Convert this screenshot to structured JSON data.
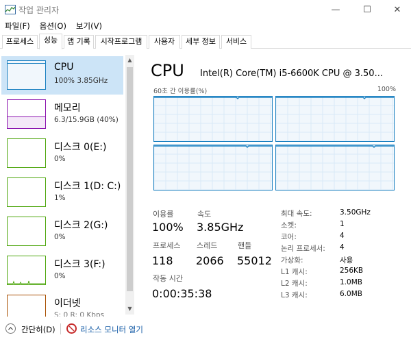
{
  "window": {
    "title": "작업 관리자",
    "minimize": "—",
    "maximize": "☐",
    "close": "✕"
  },
  "menu": [
    "파일(F)",
    "옵션(O)",
    "보기(V)"
  ],
  "tabs": [
    "프로세스",
    "성능",
    "앱 기록",
    "시작프로그램",
    "사용자",
    "세부 정보",
    "서비스"
  ],
  "sidebar": [
    {
      "name": "CPU",
      "sub": "100% 3.85GHz",
      "color": "#1a80c0"
    },
    {
      "name": "메모리",
      "sub": "6.3/15.9GB (40%)",
      "color": "#8b12ae"
    },
    {
      "name": "디스크 0(E:)",
      "sub": "0%",
      "color": "#4da60c"
    },
    {
      "name": "디스크 1(D: C:)",
      "sub": "1%",
      "color": "#4da60c"
    },
    {
      "name": "디스크 2(G:)",
      "sub": "0%",
      "color": "#4da60c"
    },
    {
      "name": "디스크 3(F:)",
      "sub": "0%",
      "color": "#4da60c"
    },
    {
      "name": "이더넷",
      "sub": "S: 0  R: 0 Kbps",
      "color": "#a74f01"
    }
  ],
  "detail": {
    "title": "CPU",
    "model": "Intel(R) Core(TM) i5-6600K CPU @ 3.50...",
    "graph_caption": "60초 간 이용률(%)",
    "graph_max": "100%",
    "stats": {
      "utilization_label": "이용률",
      "utilization_value": "100%",
      "speed_label": "속도",
      "speed_value": "3.85GHz",
      "processes_label": "프로세스",
      "processes_value": "118",
      "threads_label": "스레드",
      "threads_value": "2066",
      "handles_label": "핸들",
      "handles_value": "55012",
      "uptime_label": "작동 시간",
      "uptime_value": "0:00:35:38"
    },
    "specs": [
      {
        "label": "최대 속도:",
        "value": "3.50GHz"
      },
      {
        "label": "소켓:",
        "value": "1"
      },
      {
        "label": "코어:",
        "value": "4"
      },
      {
        "label": "논리 프로세서:",
        "value": "4"
      },
      {
        "label": "가상화:",
        "value": "사용"
      },
      {
        "label": "L1 캐시:",
        "value": "256KB"
      },
      {
        "label": "L2 캐시:",
        "value": "1.0MB"
      },
      {
        "label": "L3 캐시:",
        "value": "6.0MB"
      }
    ]
  },
  "footer": {
    "collapse": "간단히(D)",
    "resource_monitor": "리소스 모니터 열기"
  }
}
